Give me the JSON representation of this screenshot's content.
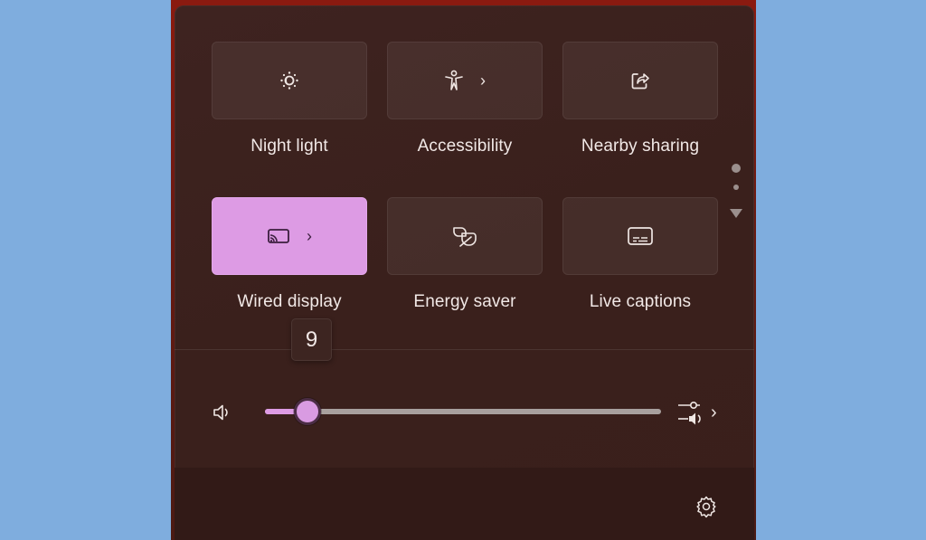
{
  "quick_settings": {
    "tiles": [
      {
        "label": "Night light",
        "icon": "night-light-icon",
        "active": false,
        "has_chevron": false
      },
      {
        "label": "Accessibility",
        "icon": "accessibility-icon",
        "active": false,
        "has_chevron": true
      },
      {
        "label": "Nearby sharing",
        "icon": "share-icon",
        "active": false,
        "has_chevron": false
      },
      {
        "label": "Wired display",
        "icon": "cast-icon",
        "active": true,
        "has_chevron": true
      },
      {
        "label": "Energy saver",
        "icon": "leaf-icon",
        "active": false,
        "has_chevron": false
      },
      {
        "label": "Live captions",
        "icon": "captions-icon",
        "active": false,
        "has_chevron": false
      }
    ],
    "chevron_glyph": "›",
    "pager": {
      "current_page": 1,
      "total_pages": 2
    }
  },
  "volume": {
    "value": 9,
    "max": 100,
    "tooltip": "9",
    "icon": "speaker-icon",
    "mixer_icon": "sound-mixer-icon",
    "mixer_chevron": "›"
  },
  "colors": {
    "accent": "#dd9be4",
    "panel_bg": "#3a201c",
    "desktop_bg": "#7fadde"
  },
  "footer": {
    "settings_icon": "gear-icon"
  }
}
